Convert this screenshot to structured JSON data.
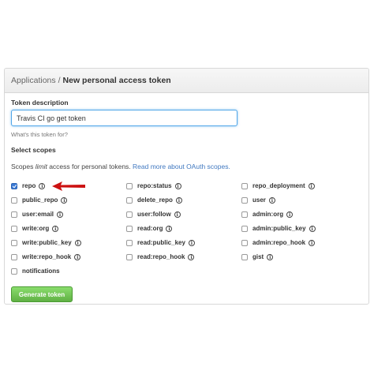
{
  "breadcrumb": {
    "parent": "Applications",
    "separator": "/",
    "current": "New personal access token"
  },
  "token_description": {
    "label": "Token description",
    "value": "Travis CI go get token",
    "hint": "What's this token for?"
  },
  "scopes": {
    "heading": "Select scopes",
    "desc_prefix": "Scopes ",
    "desc_emphasis": "limit",
    "desc_middle": " access for personal tokens. ",
    "desc_link": "Read more about OAuth scopes.",
    "info_glyph": "i",
    "items": [
      {
        "label": "repo",
        "checked": true,
        "info": true
      },
      {
        "label": "repo:status",
        "checked": false,
        "info": true
      },
      {
        "label": "repo_deployment",
        "checked": false,
        "info": true
      },
      {
        "label": "public_repo",
        "checked": false,
        "info": true
      },
      {
        "label": "delete_repo",
        "checked": false,
        "info": true
      },
      {
        "label": "user",
        "checked": false,
        "info": true
      },
      {
        "label": "user:email",
        "checked": false,
        "info": true
      },
      {
        "label": "user:follow",
        "checked": false,
        "info": true
      },
      {
        "label": "admin:org",
        "checked": false,
        "info": true
      },
      {
        "label": "write:org",
        "checked": false,
        "info": true
      },
      {
        "label": "read:org",
        "checked": false,
        "info": true
      },
      {
        "label": "admin:public_key",
        "checked": false,
        "info": true
      },
      {
        "label": "write:public_key",
        "checked": false,
        "info": true
      },
      {
        "label": "read:public_key",
        "checked": false,
        "info": true
      },
      {
        "label": "admin:repo_hook",
        "checked": false,
        "info": true
      },
      {
        "label": "write:repo_hook",
        "checked": false,
        "info": true
      },
      {
        "label": "read:repo_hook",
        "checked": false,
        "info": true
      },
      {
        "label": "gist",
        "checked": false,
        "info": true
      },
      {
        "label": "notifications",
        "checked": false,
        "info": false
      }
    ]
  },
  "generate_button": {
    "label": "Generate token"
  },
  "colors": {
    "link": "#4078c0",
    "button_green": "#6cc644",
    "arrow_red": "#cc1111",
    "checkbox_checked": "#3b7bd6"
  }
}
